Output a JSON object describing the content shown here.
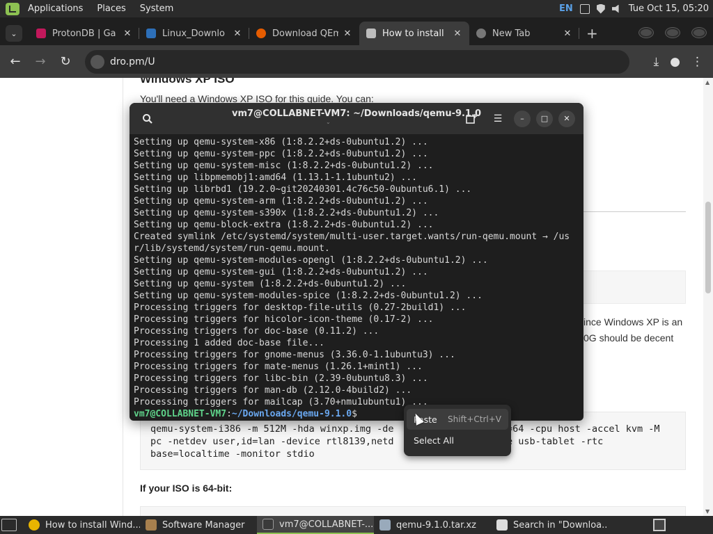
{
  "top_panel": {
    "menu": [
      "Applications",
      "Places",
      "System"
    ],
    "lang": "EN",
    "clock": "Tue Oct 15, 05:20"
  },
  "browser": {
    "tabs": [
      {
        "title": "ProtonDB | Ga",
        "favicon_color": "#c2185b"
      },
      {
        "title": "Linux_Downlo",
        "favicon_color": "#2d6fb8"
      },
      {
        "title": "Download QEm",
        "favicon_color": "#e65c00"
      },
      {
        "title": "How to install",
        "favicon_color": "#bdbdbd",
        "active": true
      },
      {
        "title": "New Tab",
        "favicon_color": "#777777"
      }
    ],
    "address": "dro.pm/U"
  },
  "page": {
    "heading": "Windows XP ISO",
    "para": "You'll need a Windows XP ISO for this guide. You can:",
    "frag_line1": "ince Windows XP is an",
    "frag_line2": "0G should be decent",
    "code_lines": [
      "qemu-system-i386 -m 512M -hda winxp.img -de                    =64 -cpu host -accel kvm -M",
      "pc -netdev user,id=lan -device rtl8139,netd                    e usb-tablet -rtc",
      "base=localtime -monitor stdio"
    ],
    "subheading": "If your ISO is 64-bit:"
  },
  "terminal": {
    "title": "vm7@COLLABNET-VM7: ~/Downloads/qemu-9.1.0",
    "lines": [
      "Setting up qemu-system-x86 (1:8.2.2+ds-0ubuntu1.2) ...",
      "Setting up qemu-system-ppc (1:8.2.2+ds-0ubuntu1.2) ...",
      "Setting up qemu-system-misc (1:8.2.2+ds-0ubuntu1.2) ...",
      "Setting up libpmemobj1:amd64 (1.13.1-1.1ubuntu2) ...",
      "Setting up librbd1 (19.2.0~git20240301.4c76c50-0ubuntu6.1) ...",
      "Setting up qemu-system-arm (1:8.2.2+ds-0ubuntu1.2) ...",
      "Setting up qemu-system-s390x (1:8.2.2+ds-0ubuntu1.2) ...",
      "Setting up qemu-block-extra (1:8.2.2+ds-0ubuntu1.2) ...",
      "Created symlink /etc/systemd/system/multi-user.target.wants/run-qemu.mount → /us",
      "r/lib/systemd/system/run-qemu.mount.",
      "Setting up qemu-system-modules-opengl (1:8.2.2+ds-0ubuntu1.2) ...",
      "Setting up qemu-system-gui (1:8.2.2+ds-0ubuntu1.2) ...",
      "Setting up qemu-system (1:8.2.2+ds-0ubuntu1.2) ...",
      "Setting up qemu-system-modules-spice (1:8.2.2+ds-0ubuntu1.2) ...",
      "Processing triggers for desktop-file-utils (0.27-2build1) ...",
      "Processing triggers for hicolor-icon-theme (0.17-2) ...",
      "Processing triggers for doc-base (0.11.2) ...",
      "Processing 1 added doc-base file...",
      "Processing triggers for gnome-menus (3.36.0-1.1ubuntu3) ...",
      "Processing triggers for mate-menus (1.26.1+mint1) ...",
      "Processing triggers for libc-bin (2.39-0ubuntu8.3) ...",
      "Processing triggers for man-db (2.12.0-4build2) ...",
      "Processing triggers for mailcap (3.70+nmu1ubuntu1) ..."
    ],
    "prompt_user": "vm7@COLLABNET-VM7",
    "prompt_sep": ":",
    "prompt_path": "~/Downloads/qemu-9.1.0",
    "prompt_end": "$"
  },
  "context_menu": {
    "paste_label": "Paste",
    "paste_accel": "Shift+Ctrl+V",
    "select_all_label": "Select All"
  },
  "taskbar": {
    "items": [
      {
        "label": "How to install Wind...",
        "icon_color": "#e8b400"
      },
      {
        "label": "Software Manager",
        "icon_color": "#a8804e"
      },
      {
        "label": "vm7@COLLABNET-...",
        "icon_color": "#3a3a3a",
        "active": true
      },
      {
        "label": "qemu-9.1.0.tar.xz",
        "icon_color": "#9ab"
      },
      {
        "label": "Search in \"Downloa...",
        "icon_color": "#ddd"
      }
    ]
  }
}
